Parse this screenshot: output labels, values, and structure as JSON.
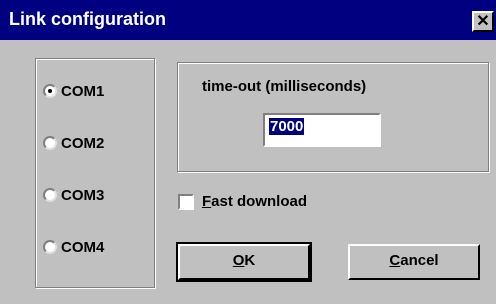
{
  "window": {
    "title": "Link configuration",
    "close_icon": "close-icon"
  },
  "ports": {
    "selected": "COM1",
    "options": [
      {
        "label": "COM1"
      },
      {
        "label": "COM2"
      },
      {
        "label": "COM3"
      },
      {
        "label": "COM4"
      }
    ]
  },
  "timeout": {
    "label": "time-out (milliseconds)",
    "value": "7000"
  },
  "fast_download": {
    "label_rest": "ast download",
    "mnemonic": "F",
    "checked": false
  },
  "buttons": {
    "ok": {
      "mnemonic": "O",
      "rest": "K"
    },
    "cancel": {
      "mnemonic": "C",
      "rest": "ancel"
    }
  },
  "colors": {
    "titlebar": "#000080",
    "face": "#c0c0c0",
    "highlight": "#000080"
  }
}
